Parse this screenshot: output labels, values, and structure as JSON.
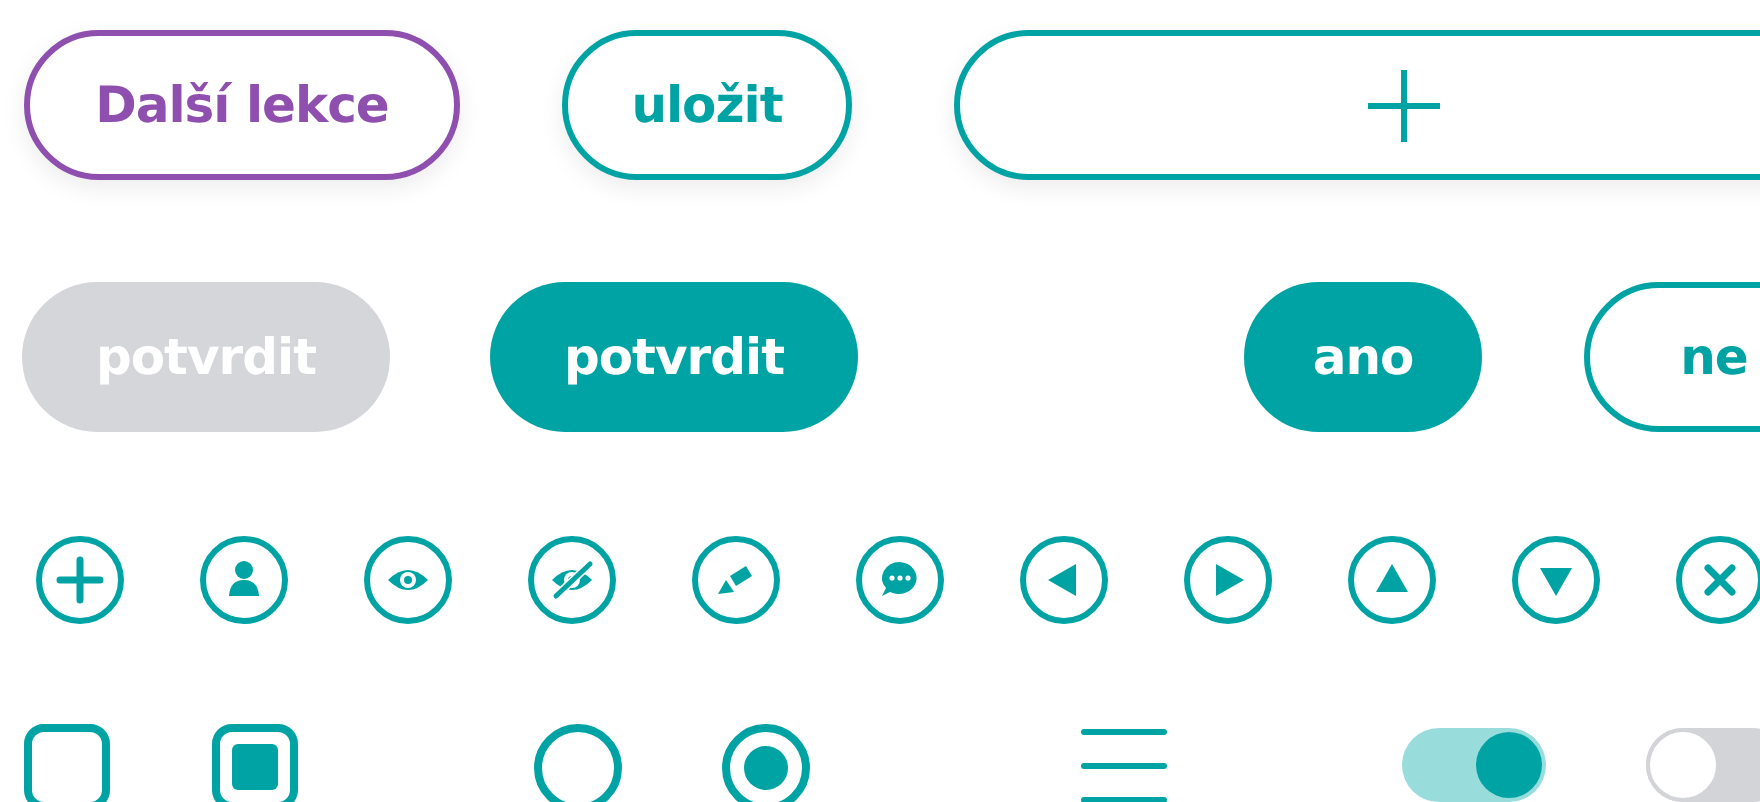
{
  "top_buttons": [
    {
      "kind": "accent",
      "label": "Další lekce"
    },
    {
      "kind": "outline",
      "label": "uložit"
    },
    {
      "kind": "add"
    }
  ],
  "action_buttons": [
    {
      "label": "potvrdit",
      "disabled": true
    },
    {
      "label": "potvrdit",
      "disabled": false
    }
  ],
  "choice_buttons": [
    {
      "label": "ano",
      "selected": true
    },
    {
      "label": "ne",
      "selected": false
    }
  ],
  "checkboxes": [
    {
      "checked": false
    },
    {
      "checked": true
    }
  ],
  "radios": [
    {
      "selected": false
    },
    {
      "selected": true
    }
  ],
  "toggles": [
    {
      "on": true
    },
    {
      "on": false
    }
  ]
}
